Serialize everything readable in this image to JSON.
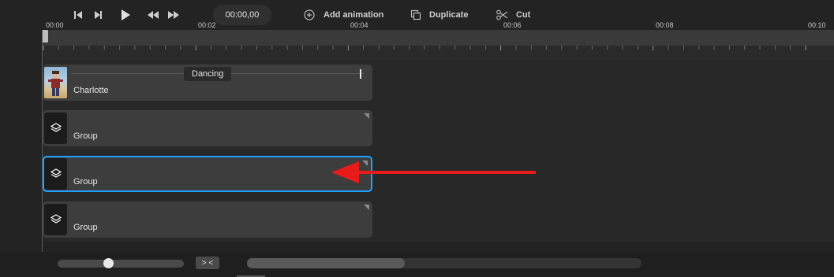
{
  "toolbar": {
    "time_display": "00:00,00",
    "add_animation_label": "Add animation",
    "duplicate_label": "Duplicate",
    "cut_label": "Cut"
  },
  "ruler": {
    "ticks": [
      "00:00",
      "00:02",
      "00:04",
      "00:06",
      "00:08",
      "00:10"
    ]
  },
  "tracks": [
    {
      "label": "Charlotte",
      "type": "character",
      "animation": "Dancing",
      "selected": false
    },
    {
      "label": "Group",
      "type": "group",
      "selected": false
    },
    {
      "label": "Group",
      "type": "group",
      "selected": true
    },
    {
      "label": "Group",
      "type": "group",
      "selected": false
    }
  ],
  "bottom": {
    "zoom_level": 0.4,
    "fit_label": "> <",
    "hscroll_visible_fraction": 0.4
  },
  "colors": {
    "selection": "#1ea1ff",
    "annotation_arrow": "#e81b1b"
  }
}
